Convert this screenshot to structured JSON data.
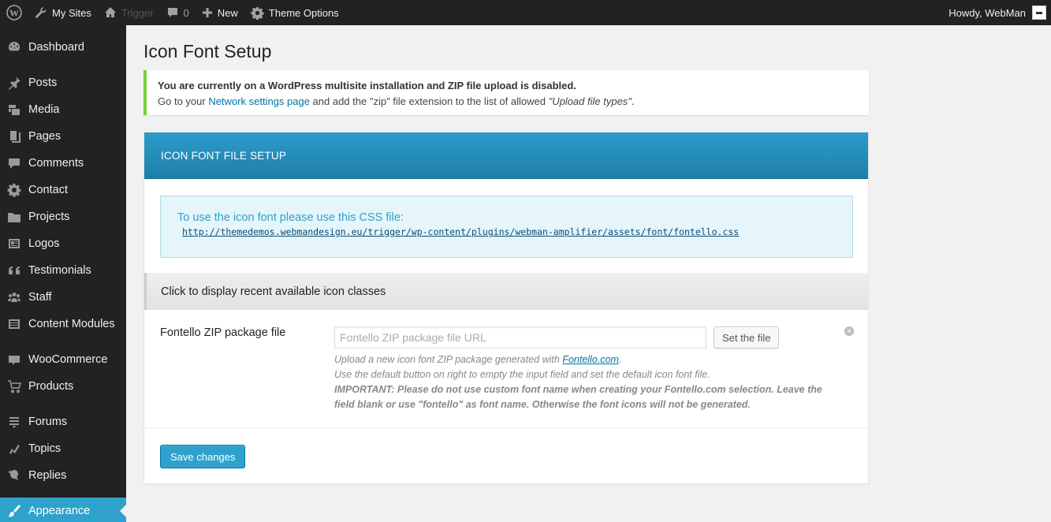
{
  "admin_bar": {
    "my_sites": "My Sites",
    "site_name": "Trigger",
    "comments_count": "0",
    "new_label": "New",
    "theme_options": "Theme Options",
    "greeting": "Howdy, WebMan"
  },
  "sidebar": {
    "items": [
      {
        "label": "Dashboard",
        "icon": "dashboard-icon"
      },
      {
        "label": "Posts",
        "icon": "pin-icon"
      },
      {
        "label": "Media",
        "icon": "media-icon"
      },
      {
        "label": "Pages",
        "icon": "pages-icon"
      },
      {
        "label": "Comments",
        "icon": "comment-icon"
      },
      {
        "label": "Contact",
        "icon": "gear-icon"
      },
      {
        "label": "Projects",
        "icon": "folder-icon"
      },
      {
        "label": "Logos",
        "icon": "id-card-icon"
      },
      {
        "label": "Testimonials",
        "icon": "quote-icon"
      },
      {
        "label": "Staff",
        "icon": "group-icon"
      },
      {
        "label": "Content Modules",
        "icon": "list-icon"
      },
      {
        "label": "WooCommerce",
        "icon": "woo-icon"
      },
      {
        "label": "Products",
        "icon": "cart-icon"
      },
      {
        "label": "Forums",
        "icon": "forum-icon"
      },
      {
        "label": "Topics",
        "icon": "topic-icon"
      },
      {
        "label": "Replies",
        "icon": "reply-icon"
      },
      {
        "label": "Appearance",
        "icon": "brush-icon",
        "current": true
      }
    ]
  },
  "page": {
    "title": "Icon Font Setup"
  },
  "notice": {
    "bold_text": "You are currently on a WordPress multisite installation and ZIP file upload is disabled.",
    "line2_before": "Go to your ",
    "link_text": "Network settings page",
    "line2_middle": " and add the \"zip\" file extension to the list of allowed ",
    "italic_text": "\"Upload file types\"",
    "line2_end": "."
  },
  "panel": {
    "header": "ICON FONT FILE SETUP",
    "info_text": "To use the icon font please use this CSS file:",
    "css_url": "http://themedemos.webmandesign.eu/trigger/wp-content/plugins/webman-amplifier/assets/font/fontello.css",
    "toggle_label": "Click to display recent available icon classes",
    "field_label": "Fontello ZIP package file",
    "field_placeholder": "Fontello ZIP package file URL",
    "field_value": "",
    "set_file_button": "Set the file",
    "desc_line1_before": "Upload a new icon font ZIP package generated with ",
    "desc_link": "Fontello.com",
    "desc_line1_end": ".",
    "desc_line2": "Use the default button on right to empty the input field and set the default icon font file.",
    "desc_important": "IMPORTANT: Please do not use custom font name when creating your Fontello.com selection. Leave the field blank or use \"fontello\" as font name. Otherwise the font icons will not be generated.",
    "save_button": "Save changes"
  },
  "colors": {
    "admin_bar_bg": "#222222",
    "accent": "#2ea2cc",
    "notice_border": "#7ad03a"
  }
}
